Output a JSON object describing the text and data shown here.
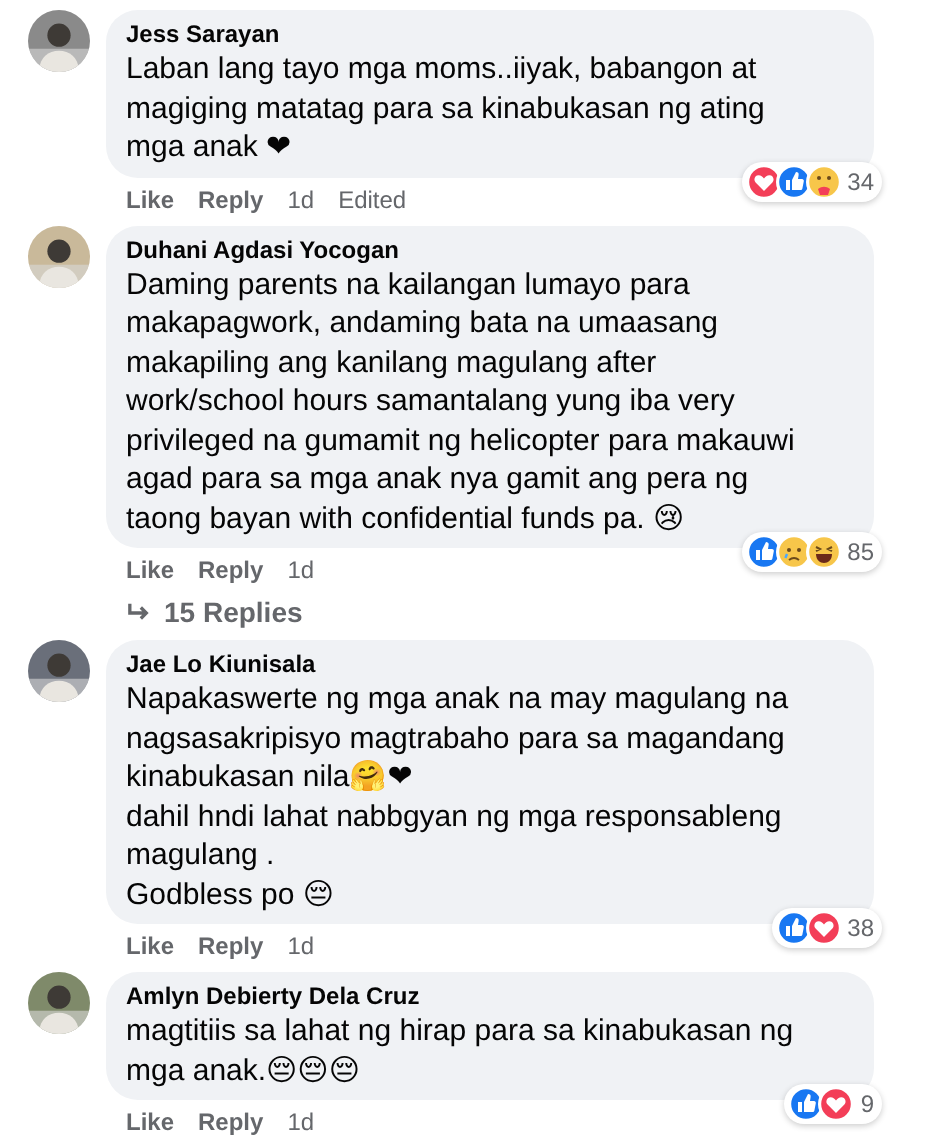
{
  "comments": [
    {
      "author": "Jess Sarayan",
      "paragraphs": [
        "Laban lang tayo mga moms..iiyak, babangon at magiging matatag para sa kinabukasan ng ating mga anak ❤"
      ],
      "reactions": [
        {
          "kind": "love"
        },
        {
          "kind": "like"
        },
        {
          "kind": "care"
        }
      ],
      "reaction_count": "34",
      "actions": [
        "Like",
        "Reply"
      ],
      "time": "1d",
      "edited_label": "Edited"
    },
    {
      "author": "Duhani Agdasi Yocogan",
      "paragraphs": [
        "Daming parents na kailangan lumayo para makapagwork, andaming bata na umaasang makapiling ang kanilang magulang after work/school hours samantalang yung iba very privileged na gumamit ng helicopter para makauwi agad para sa mga anak nya gamit ang pera ng taong bayan with confidential funds pa. 😢"
      ],
      "reactions": [
        {
          "kind": "like"
        },
        {
          "kind": "sad"
        },
        {
          "kind": "haha"
        }
      ],
      "reaction_count": "85",
      "actions": [
        "Like",
        "Reply"
      ],
      "time": "1d",
      "replies_label": "15 Replies"
    },
    {
      "author": "Jae Lo Kiunisala",
      "paragraphs": [
        "Napakaswerte ng mga anak na may magulang na nagsasakripisyo magtrabaho para sa magandang kinabukasan nila🤗❤",
        "dahil hndi lahat nabbgyan ng mga responsableng magulang .",
        "Godbless po 😔"
      ],
      "reactions": [
        {
          "kind": "like"
        },
        {
          "kind": "love"
        }
      ],
      "reaction_count": "38",
      "actions": [
        "Like",
        "Reply"
      ],
      "time": "1d"
    },
    {
      "author": "Amlyn Debierty Dela Cruz",
      "paragraphs": [
        "magtitiis sa lahat ng hirap para sa kinabukasan ng mga anak.😔😔😔"
      ],
      "reactions": [
        {
          "kind": "like"
        },
        {
          "kind": "love"
        }
      ],
      "reaction_count": "9",
      "actions": [
        "Like",
        "Reply"
      ],
      "time": "1d"
    }
  ]
}
